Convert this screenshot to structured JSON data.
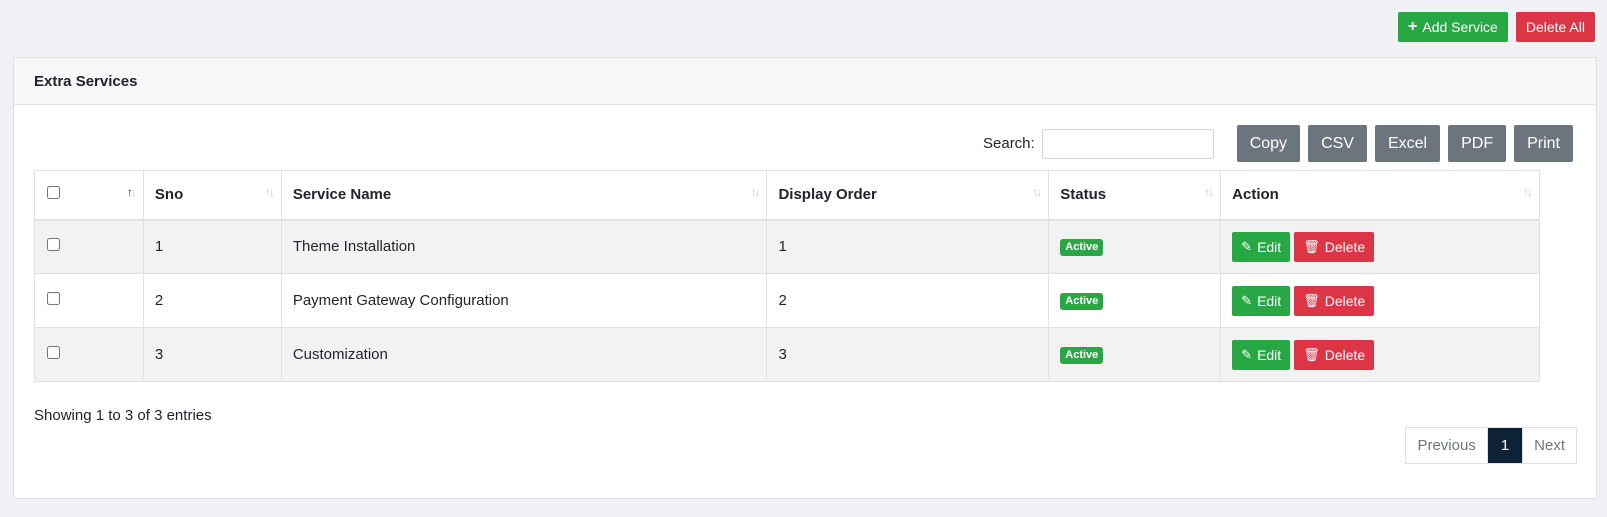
{
  "header_actions": {
    "add_label": "Add Service",
    "delete_all_label": "Delete All"
  },
  "card": {
    "title": "Extra Services"
  },
  "toolbar": {
    "search_label": "Search:",
    "search_value": "",
    "export_buttons": [
      "Copy",
      "CSV",
      "Excel",
      "PDF",
      "Print"
    ]
  },
  "table": {
    "columns": [
      "",
      "Sno",
      "Service Name",
      "Display Order",
      "Status",
      "Action"
    ],
    "rows": [
      {
        "sno": "1",
        "name": "Theme Installation",
        "order": "1",
        "status": "Active"
      },
      {
        "sno": "2",
        "name": "Payment Gateway Configuration",
        "order": "2",
        "status": "Active"
      },
      {
        "sno": "3",
        "name": "Customization",
        "order": "3",
        "status": "Active"
      }
    ],
    "row_actions": {
      "edit_label": "Edit",
      "delete_label": "Delete"
    }
  },
  "info": "Showing 1 to 3 of 3 entries",
  "pagination": {
    "previous": "Previous",
    "current": "1",
    "next": "Next"
  },
  "colors": {
    "success": "#28a745",
    "danger": "#dc3545",
    "secondary": "#6c757d",
    "page_active": "#0d2236"
  },
  "icons": {
    "add": "plus-icon",
    "edit": "edit-icon",
    "delete": "trash-icon",
    "sort": "sort-icon"
  }
}
